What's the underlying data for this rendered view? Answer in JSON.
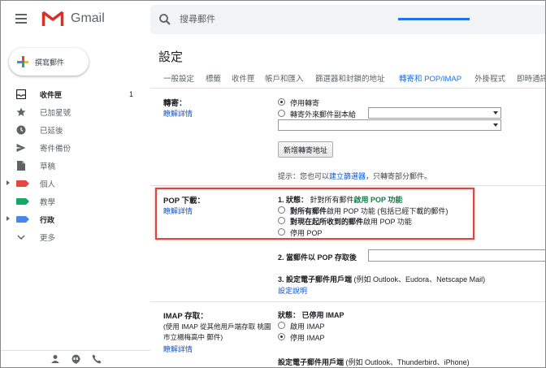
{
  "brand": {
    "name": "Gmail"
  },
  "search": {
    "placeholder": "搜尋郵件"
  },
  "compose": {
    "label": "撰寫郵件"
  },
  "sidebar": {
    "items": [
      {
        "label": "收件匣",
        "count": "1",
        "icon": "inbox-icon"
      },
      {
        "label": "已加星號",
        "icon": "star-icon"
      },
      {
        "label": "已延後",
        "icon": "clock-icon"
      },
      {
        "label": "寄件備份",
        "icon": "send-icon"
      },
      {
        "label": "草稿",
        "icon": "draft-icon"
      },
      {
        "label": "個人",
        "icon": "label-icon",
        "color": "#e8453c"
      },
      {
        "label": "教學",
        "icon": "label-icon",
        "color": "#16a765"
      },
      {
        "label": "行政",
        "icon": "label-icon",
        "color": "#4986e7"
      },
      {
        "label": "更多",
        "icon": "chevron-down-icon"
      }
    ]
  },
  "settings": {
    "title": "設定",
    "tabs": [
      "一般設定",
      "標籤",
      "收件匣",
      "帳戶和匯入",
      "篩選器和封鎖的地址",
      "轉寄和 POP/IMAP",
      "外掛程式",
      "即時通訊"
    ],
    "forwarding": {
      "label": "轉寄：",
      "learn_more": "瞭解詳情",
      "option_disable": "停用轉寄",
      "option_forward": "轉寄外來郵件副本給",
      "add_button": "新增轉寄地址",
      "tip_prefix": "提示：您也可以",
      "tip_link": "建立篩選器",
      "tip_suffix": "，只轉寄部分郵件。"
    },
    "pop": {
      "label": "POP 下載：",
      "learn_more": "瞭解詳情",
      "status_prefix": "1. 狀態：",
      "status_text": "針對所有郵件",
      "status_value": "啟用 POP 功能",
      "opt1_bold": "對所有郵件",
      "opt1_rest": "啟用 POP 功能 (包括已經下載的郵件)",
      "opt2_bold": "對現在起所收到的郵件",
      "opt2_rest": "啟用 POP 功能",
      "opt3": "停用 POP",
      "step2": "2. 當郵件以 POP 存取後",
      "step3_bold": "3. 設定電子郵件用戶端",
      "step3_rest": "(例如 Outlook、Eudora、Netscape Mail)",
      "setup_link": "設定說明"
    },
    "imap": {
      "label": "IMAP 存取：",
      "desc": "(使用 IMAP 從其他用戶端存取 桃園市立楊梅高中 郵件)",
      "learn_more": "瞭解詳情",
      "status_prefix": "狀態：",
      "status_value": "已停用 IMAP",
      "opt_enable": "啟用 IMAP",
      "opt_disable": "停用 IMAP",
      "client_bold": "設定電子郵件用戶端",
      "client_rest": "(例如 Outlook、Thunderbird、iPhone)"
    }
  },
  "colors": {
    "accent": "#1a73e8",
    "highlight": "#e0443e",
    "status_green": "#0b8043"
  }
}
